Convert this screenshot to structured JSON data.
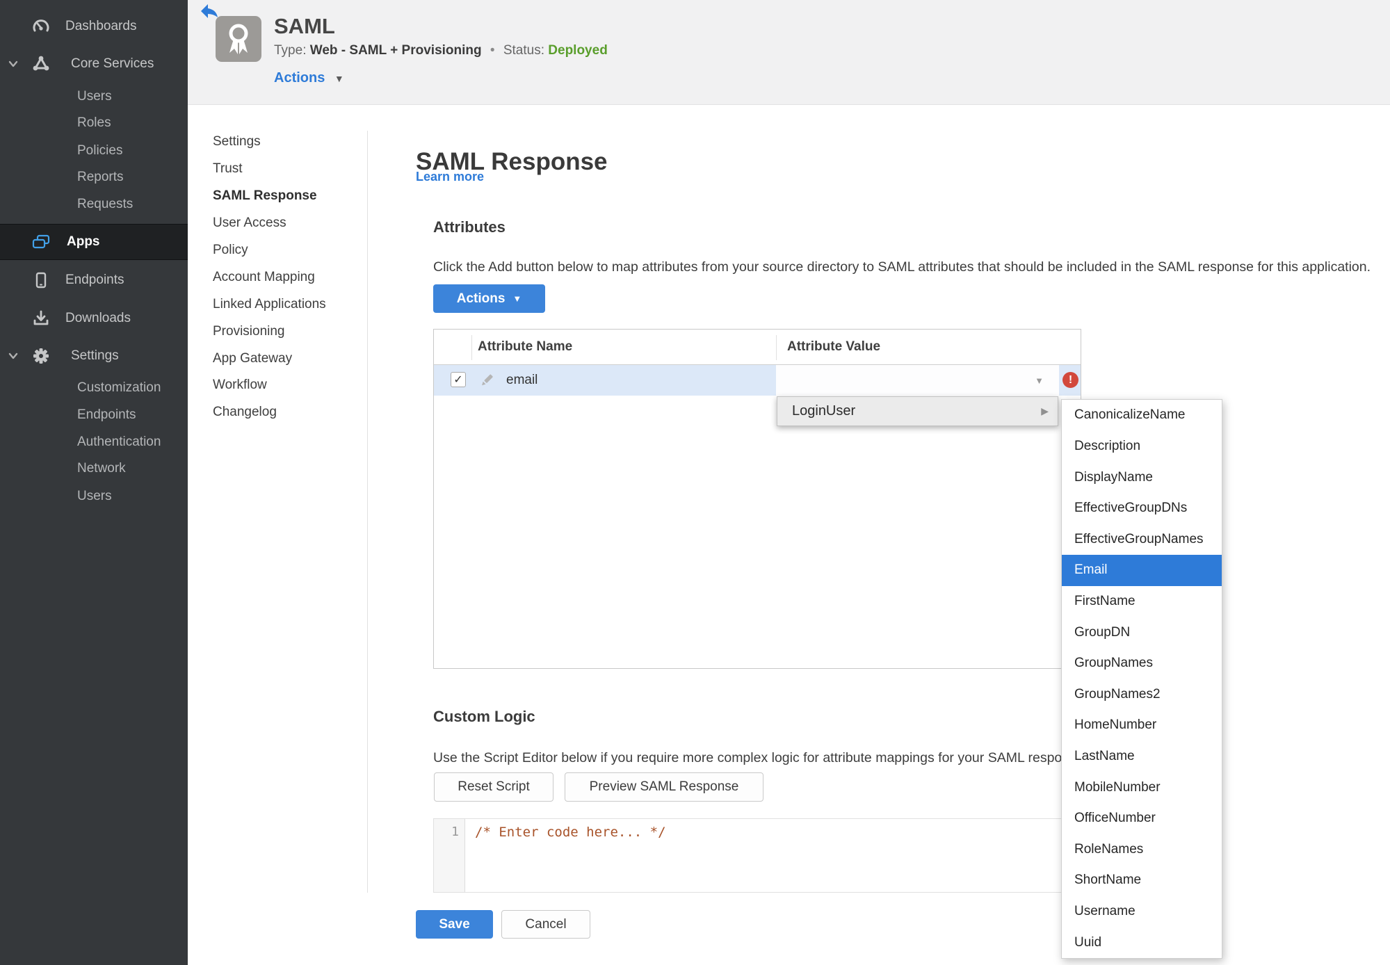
{
  "colors": {
    "accent_blue": "#2e7bd8",
    "button_blue": "#3c84da",
    "status_green": "#5a9e2c",
    "error_red": "#d2483c",
    "row_highlight": "#dce8f8",
    "sidebar_bg": "#35383b"
  },
  "sidebar": {
    "items": [
      {
        "label": "Dashboards",
        "icon": "gauge-icon"
      },
      {
        "label": "Core Services",
        "icon": "core-services-icon",
        "expanded": true,
        "children": [
          "Users",
          "Roles",
          "Policies",
          "Reports",
          "Requests"
        ]
      },
      {
        "label": "Apps",
        "icon": "apps-icon",
        "active": true
      },
      {
        "label": "Endpoints",
        "icon": "device-icon"
      },
      {
        "label": "Downloads",
        "icon": "download-icon"
      },
      {
        "label": "Settings",
        "icon": "gear-icon",
        "expanded": true,
        "children": [
          "Customization",
          "Endpoints",
          "Authentication",
          "Network",
          "Users"
        ]
      }
    ]
  },
  "header": {
    "back_icon": "back-arrow-icon",
    "app_icon": "award-ribbon-icon",
    "title": "SAML",
    "type_label": "Type:",
    "type_value": "Web - SAML + Provisioning",
    "dot": "•",
    "status_label": "Status:",
    "status_value": "Deployed",
    "actions_label": "Actions"
  },
  "subnav": {
    "active": "SAML Response",
    "items": [
      {
        "label": "Settings"
      },
      {
        "label": "Trust"
      },
      {
        "label": "SAML Response",
        "active": true
      },
      {
        "label": "User Access"
      },
      {
        "label": "Policy"
      },
      {
        "label": "Account Mapping"
      },
      {
        "label": "Linked Applications"
      },
      {
        "label": "Provisioning"
      },
      {
        "label": "App Gateway"
      },
      {
        "label": "Workflow"
      },
      {
        "label": "Changelog"
      }
    ]
  },
  "main": {
    "title": "SAML Response",
    "learn_more": "Learn more",
    "attributes": {
      "heading": "Attributes",
      "description": "Click the Add button below to map attributes from your source directory to SAML attributes that should be included in the SAML response for this application.",
      "actions_button": "Actions",
      "table": {
        "columns": [
          "Attribute Name",
          "Attribute Value"
        ],
        "rows": [
          {
            "name": "email",
            "checked": true,
            "value": ""
          }
        ]
      }
    },
    "custom_logic": {
      "heading": "Custom Logic",
      "description": "Use the Script Editor below if you require more complex logic for attribute mappings for your SAML response.",
      "reset_button": "Reset Script",
      "preview_button": "Preview SAML Response",
      "editor": {
        "line_number": "1",
        "code": "/* Enter code here... */"
      }
    },
    "save_button": "Save",
    "cancel_button": "Cancel"
  },
  "value_menu": {
    "parent": "LoginUser",
    "options": [
      {
        "label": "CanonicalizeName"
      },
      {
        "label": "Description"
      },
      {
        "label": "DisplayName"
      },
      {
        "label": "EffectiveGroupDNs"
      },
      {
        "label": "EffectiveGroupNames"
      },
      {
        "label": "Email",
        "selected": true
      },
      {
        "label": "FirstName"
      },
      {
        "label": "GroupDN"
      },
      {
        "label": "GroupNames"
      },
      {
        "label": "GroupNames2"
      },
      {
        "label": "HomeNumber"
      },
      {
        "label": "LastName"
      },
      {
        "label": "MobileNumber"
      },
      {
        "label": "OfficeNumber"
      },
      {
        "label": "RoleNames"
      },
      {
        "label": "ShortName"
      },
      {
        "label": "Username"
      },
      {
        "label": "Uuid"
      }
    ]
  }
}
